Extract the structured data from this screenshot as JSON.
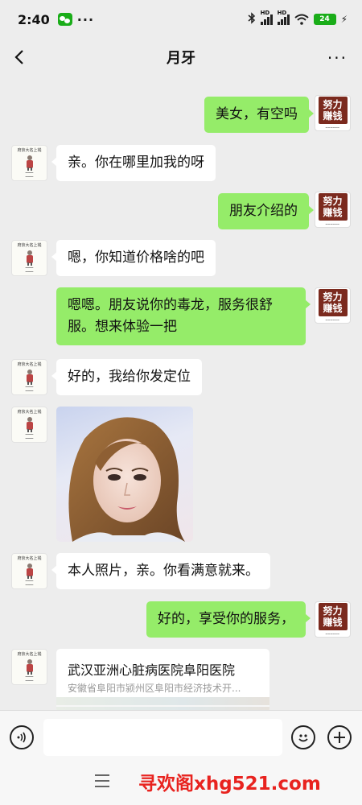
{
  "status_bar": {
    "time": "2:40",
    "dots": "···",
    "hd1": "HD",
    "hd2": "HD",
    "battery": "24"
  },
  "nav": {
    "title": "月牙",
    "more": "···"
  },
  "contacts": {
    "me_avatar_line1": "努力",
    "me_avatar_line2": "赚钱",
    "other_avatar_caption": "府京大名上钱",
    "other_avatar_caption2": "今月偏眼卷子眼 我们有对不起"
  },
  "messages": [
    {
      "from": "me",
      "text": "美女，有空吗"
    },
    {
      "from": "other",
      "text": "亲。你在哪里加我的呀"
    },
    {
      "from": "me",
      "text": "朋友介绍的"
    },
    {
      "from": "other",
      "text": "嗯，你知道价格啥的吧"
    },
    {
      "from": "me",
      "text": "嗯嗯。朋友说你的毒龙，服务很舒服。想来体验一把"
    },
    {
      "from": "other",
      "text": "好的，我给你发定位"
    },
    {
      "from": "other",
      "type": "image"
    },
    {
      "from": "other",
      "text": "本人照片，亲。你看满意就来。"
    },
    {
      "from": "me",
      "text": "好的，享受你的服务，"
    }
  ],
  "location": {
    "title": "武汉亚洲心脏病医院阜阳医院",
    "address": "安徽省阜阳市颍州区阜阳市经济技术开..."
  },
  "input": {
    "placeholder": ""
  },
  "watermark": "寻欢阁xhg521.com"
}
